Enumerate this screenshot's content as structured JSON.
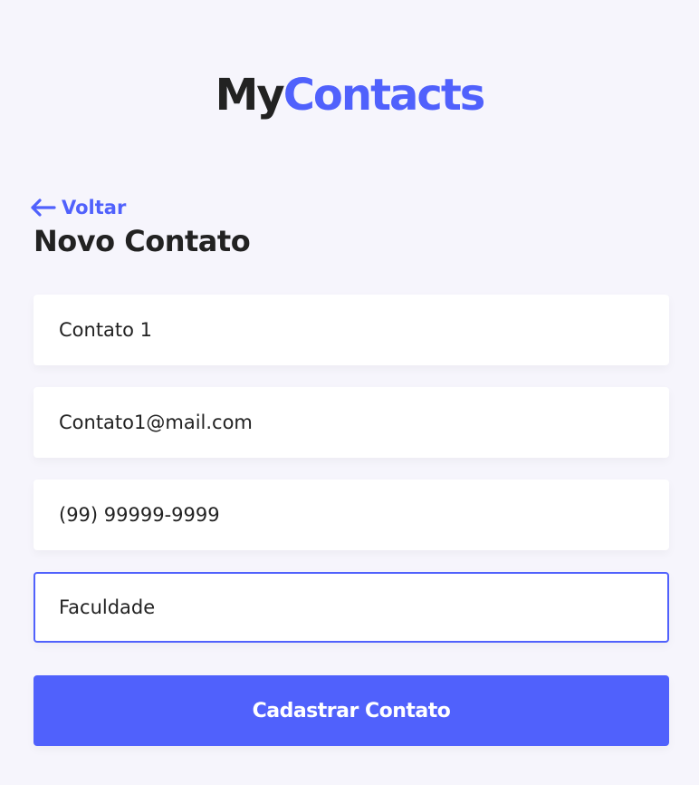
{
  "brand": {
    "part1": "My",
    "part2": "Contacts",
    "colors": {
      "dark": "#222222",
      "accent": "#5061FC"
    }
  },
  "back_link": {
    "label": "Voltar",
    "icon": "arrow-left-icon"
  },
  "page_title": "Novo Contato",
  "form": {
    "name_value": "Contato 1",
    "email_value": "Contato1@mail.com",
    "phone_value": "(99) 99999-9999",
    "category_value": "Faculdade",
    "submit_label": "Cadastrar Contato"
  },
  "colors": {
    "background": "#F6F5FC",
    "input_background": "#FFFFFF",
    "focus_border": "#5061FC",
    "button_background": "#5061FC",
    "button_text": "#FFFFFF"
  }
}
